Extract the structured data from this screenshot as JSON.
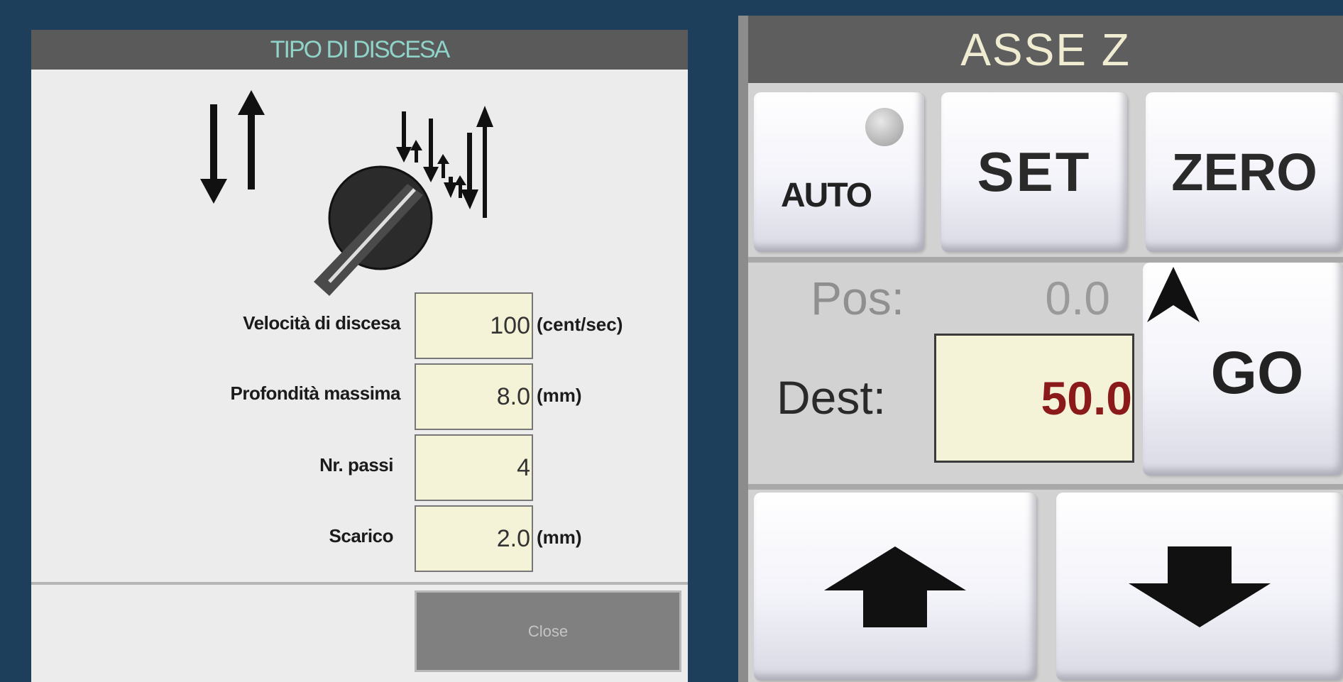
{
  "dialog": {
    "title": "TIPO DI DISCESA",
    "fields": [
      {
        "label": "Velocità di discesa",
        "value": "100",
        "unit": "(cent/sec)"
      },
      {
        "label": "Profondità massima",
        "value": "8.0",
        "unit": "(mm)"
      },
      {
        "label": "Nr. passi",
        "value": "4",
        "unit": ""
      },
      {
        "label": "Scarico",
        "value": "2.0",
        "unit": "(mm)"
      }
    ],
    "close_label": "Close"
  },
  "axis": {
    "title": "ASSE Z",
    "auto_label": "AUTO",
    "set_label": "SET",
    "zero_label": "ZERO",
    "pos_label": "Pos:",
    "pos_value": "0.0",
    "dest_label": "Dest:",
    "dest_value": "50.0",
    "go_label": "GO"
  },
  "colors": {
    "background": "#1e3f5c",
    "dialog_title_text": "#8fd3c9",
    "input_bg": "#f4f3d8",
    "dest_value": "#8b1a1a"
  }
}
